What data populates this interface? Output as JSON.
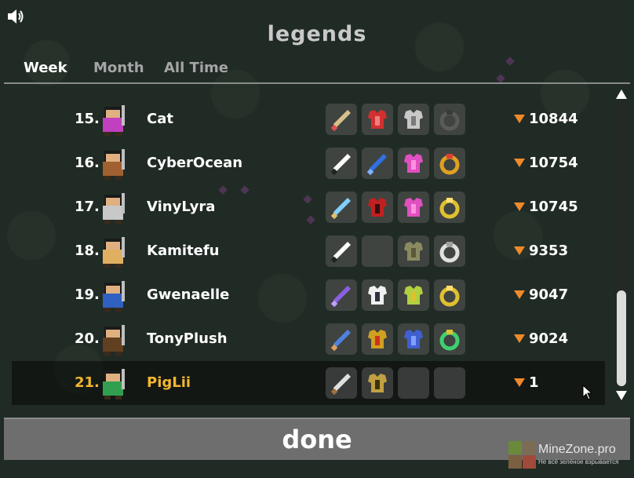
{
  "header": {
    "title": "legends"
  },
  "tabs": [
    {
      "label": "Week",
      "active": true
    },
    {
      "label": "Month",
      "active": false
    },
    {
      "label": "All Time",
      "active": false
    }
  ],
  "leaderboard": [
    {
      "rank": "15.",
      "name": "Cat",
      "score": "10844",
      "equipment": [
        "spear",
        "red-armor",
        "grey-armor",
        "stone-ring"
      ]
    },
    {
      "rank": "16.",
      "name": "CyberOcean",
      "score": "10754",
      "equipment": [
        "dark-sword",
        "blue-sword",
        "pink-armor",
        "gold-red-ring"
      ]
    },
    {
      "rank": "17.",
      "name": "VinyLyra",
      "score": "10745",
      "equipment": [
        "ice-spear",
        "red-dark-armor",
        "pink-armor",
        "gold-ring"
      ]
    },
    {
      "rank": "18.",
      "name": "Kamitefu",
      "score": "9353",
      "equipment": [
        "dark-sword",
        "empty",
        "olive-armor",
        "silver-ring"
      ]
    },
    {
      "rank": "19.",
      "name": "Gwenaelle",
      "score": "9047",
      "equipment": [
        "purple-spear",
        "white-armor",
        "green-gold-armor",
        "gold-ring"
      ]
    },
    {
      "rank": "20.",
      "name": "TonyPlush",
      "score": "9024",
      "equipment": [
        "blue-spear",
        "red-helmet-armor",
        "blue-armor",
        "green-ring"
      ]
    },
    {
      "rank": "21.",
      "name": "PigLii",
      "score": "1",
      "highlight": true,
      "equipment": [
        "short-sword",
        "gold-hood",
        "empty",
        "empty"
      ]
    }
  ],
  "footer": {
    "done_label": "done"
  },
  "watermark": {
    "title": "MineZone.pro",
    "subtitle": "Не всё зелёное взрывается"
  },
  "colors": {
    "accent_orange": "#ef8a2a",
    "highlight_gold": "#f2b630",
    "tab_inactive": "#a5a5a5"
  },
  "icons": {
    "sound": "speaker-icon",
    "score": "score-arrow-icon"
  }
}
